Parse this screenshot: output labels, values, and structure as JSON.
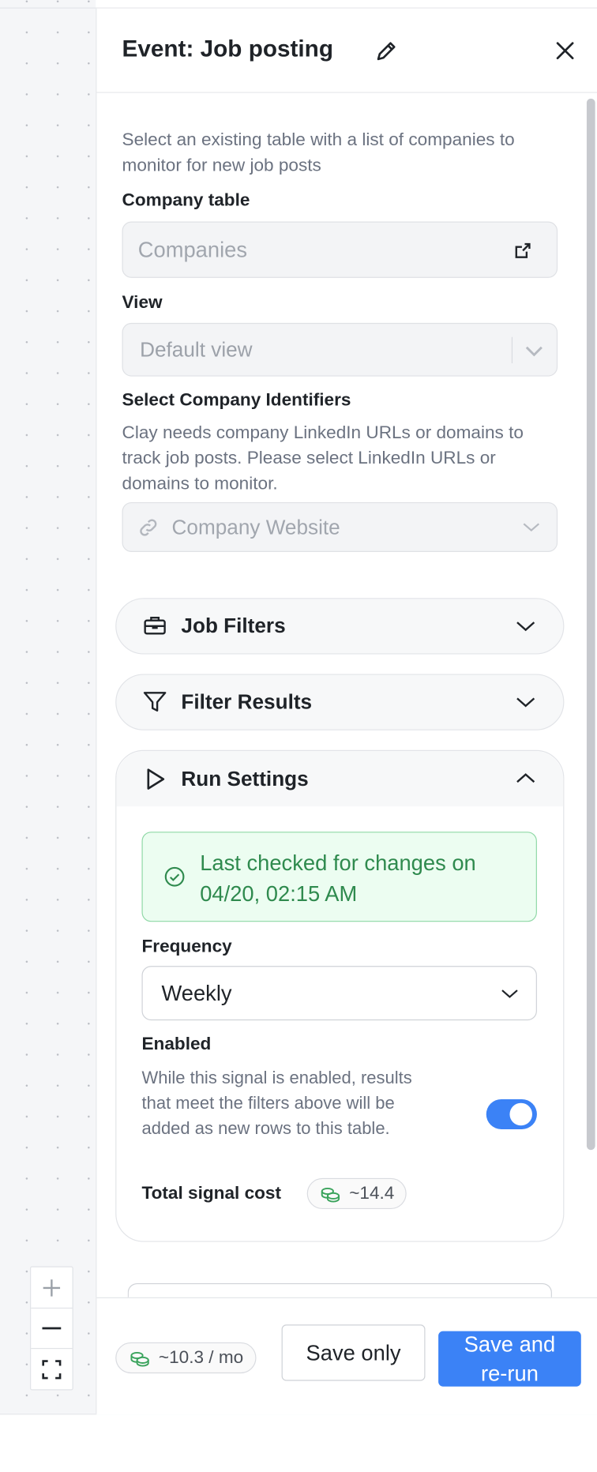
{
  "panel": {
    "title": "Event: Job posting",
    "description": "Select an existing table with a list of companies to monitor for new job posts"
  },
  "company_table": {
    "label": "Company table",
    "placeholder": "Companies"
  },
  "view": {
    "label": "View",
    "value": "Default view"
  },
  "identifiers": {
    "label": "Select Company Identifiers",
    "help": "Clay needs company LinkedIn URLs or domains to track job posts. Please select LinkedIn URLs or domains to monitor.",
    "value": "Company Website"
  },
  "sections": {
    "job_filters": "Job Filters",
    "filter_results": "Filter Results",
    "run_settings": "Run Settings"
  },
  "run_settings": {
    "last_checked": "Last checked for changes on 04/20, 02:15 AM",
    "frequency_label": "Frequency",
    "frequency_value": "Weekly",
    "enabled_label": "Enabled",
    "enabled_help": "While this signal is enabled, results that meet the filters above will be added as new rows to this table.",
    "enabled": true,
    "total_cost_label": "Total signal cost",
    "total_cost_value": "~14.4"
  },
  "footer": {
    "monthly_cost": "~10.3 / mo",
    "save_only": "Save only",
    "save_rerun": "Save and re-run"
  },
  "colors": {
    "primary": "#3b82f6",
    "success_text": "#2f8a4e",
    "success_bg": "#ecfdf1",
    "success_border": "#8fd8a6"
  },
  "icons": {
    "edit": "pencil-icon",
    "close": "close-icon",
    "external": "external-link-icon",
    "link": "link-icon",
    "briefcase": "briefcase-icon",
    "filter": "filter-icon",
    "play": "play-icon",
    "check": "check-circle-icon",
    "coins": "coins-icon",
    "zoom_in": "plus-icon",
    "zoom_out": "minus-icon",
    "fit": "fit-screen-icon"
  }
}
